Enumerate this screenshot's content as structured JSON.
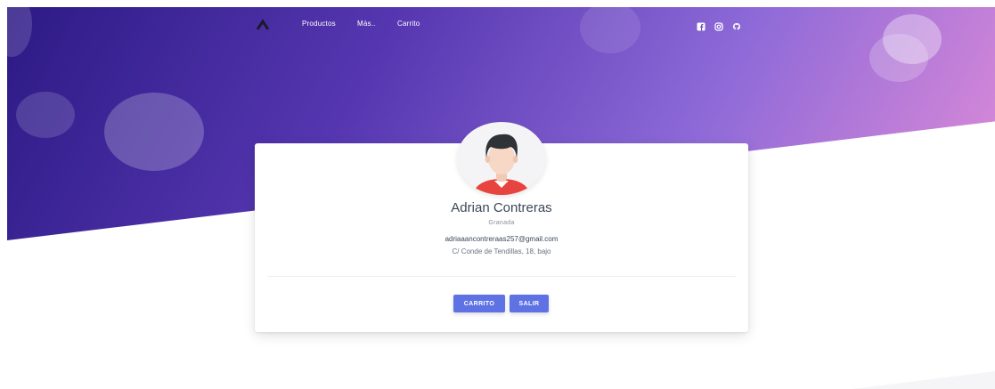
{
  "nav": {
    "links": [
      "Productos",
      "Más..",
      "Carrito"
    ],
    "logo": "chevron-up-logo",
    "social": [
      "facebook-icon",
      "instagram-icon",
      "github-icon"
    ]
  },
  "profile": {
    "name": "Adrian Contreras",
    "city": "Granada",
    "email": "adriaaancontreraas257@gmail.com",
    "address": "C/ Conde de Tendillas, 18, bajo"
  },
  "buttons": {
    "cart": "CARRITO",
    "exit": "SALIR"
  },
  "colors": {
    "accent": "#5e72e4",
    "hero_start": "#2c1a85",
    "hero_end": "#e08cd8"
  }
}
